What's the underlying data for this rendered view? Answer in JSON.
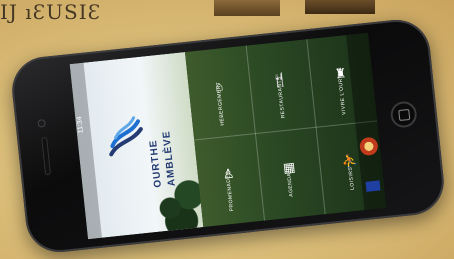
{
  "paper_text": "IJ ıƐUSIƐ",
  "app": {
    "brand_line1": "OURTHE",
    "brand_line2": "AMBLÈVE",
    "status_time": "11:34",
    "tiles": [
      {
        "label": "RESTAURANTS",
        "icon": "fork-knife-icon"
      },
      {
        "label": "HÉBERGEMENT",
        "icon": "bed-icon"
      },
      {
        "label": "PROMENADES",
        "icon": "hiker-icon"
      },
      {
        "label": "VIVRE L'OURTHE",
        "icon": "figure-icon"
      },
      {
        "label": "AGENDA",
        "icon": "calendar-icon"
      },
      {
        "label": "LOISIRS",
        "icon": "leisure-icon"
      }
    ]
  },
  "colors": {
    "brand_blue": "#233a73",
    "tile_text": "#ffffff"
  }
}
